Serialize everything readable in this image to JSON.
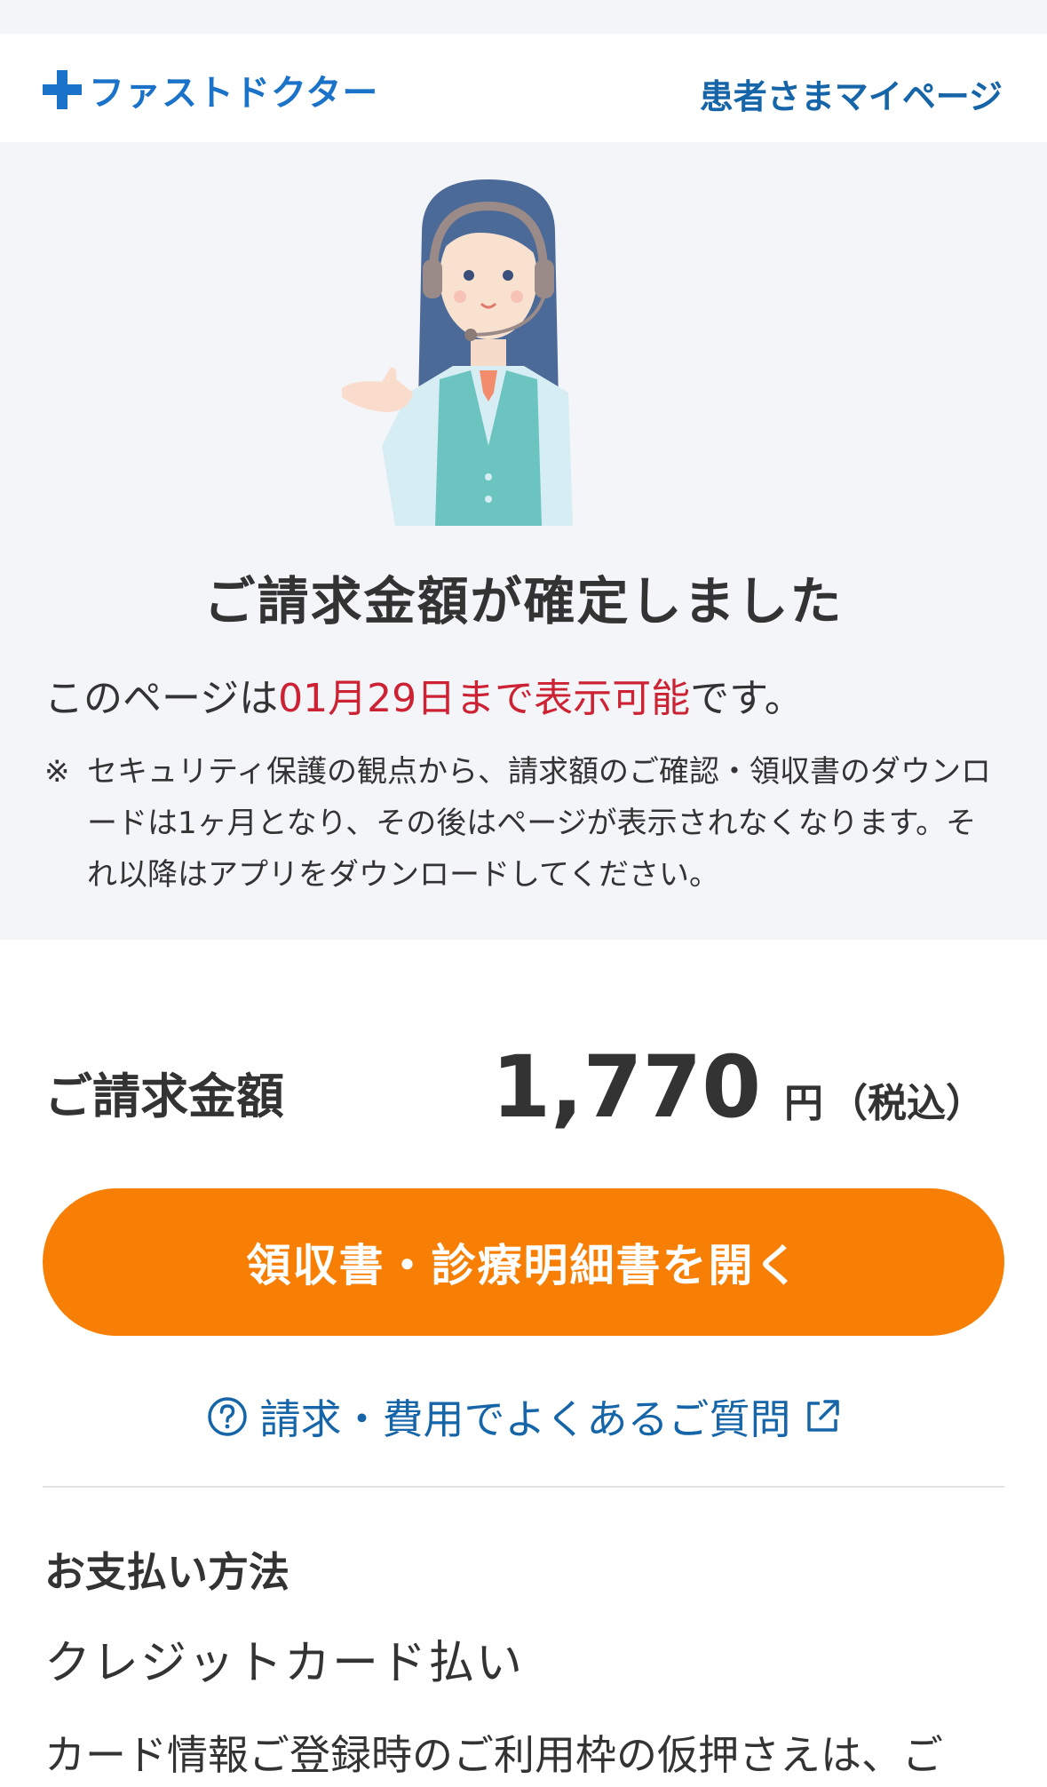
{
  "header": {
    "logo_text": "ファストドクター",
    "mypage_link": "患者さまマイページ"
  },
  "hero": {
    "title": "ご請求金額が確定しました",
    "display_prefix": "このページは",
    "display_deadline": "01月29日まで表示可能",
    "display_suffix": "です。",
    "notice_mark": "※",
    "notice_text": "セキュリティ保護の観点から、請求額のご確認・領収書のダウンロードは1ヶ月となり、その後はページが表示されなくなります。それ以降はアプリをダウンロードしてください。"
  },
  "billing": {
    "label": "ご請求金額",
    "amount": "1,770",
    "unit": "円",
    "tax": "（税込）"
  },
  "actions": {
    "open_receipt_button": "領収書・診療明細書を開く",
    "faq_link": "請求・費用でよくあるご質問"
  },
  "payment": {
    "heading": "お支払い方法",
    "method": "クレジットカード払い",
    "description": "カード情報ご登録時のご利用枠の仮押さえは、ご"
  },
  "colors": {
    "brand_blue": "#1a73c8",
    "link_blue": "#1565a8",
    "accent_orange": "#f77f05",
    "deadline_red": "#cc2233",
    "hero_bg": "#f4f5f8"
  },
  "icons": {
    "logo": "plus-cross-icon",
    "illustration": "operator-headset-illustration",
    "faq_help": "question-circle-icon",
    "faq_external": "external-link-icon"
  }
}
